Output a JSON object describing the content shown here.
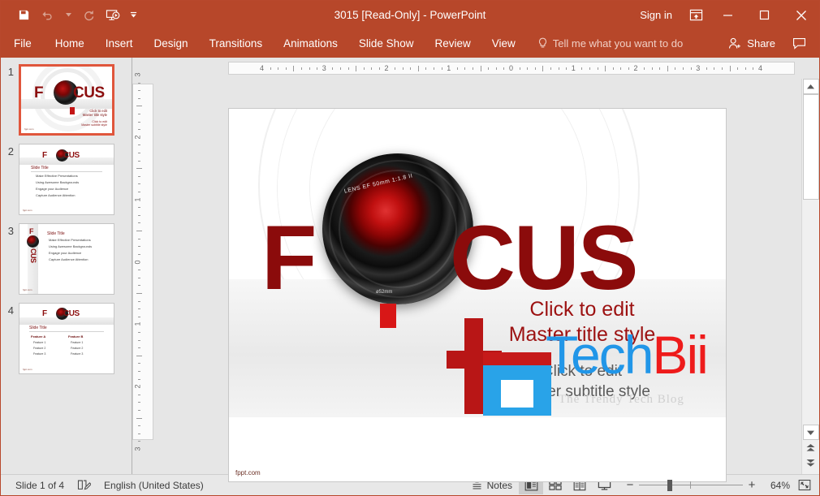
{
  "window": {
    "title": "3015 [Read-Only]  -  PowerPoint",
    "sign_in": "Sign in",
    "accent_color": "#b7472a"
  },
  "quick_access": {
    "items": [
      {
        "name": "save-icon",
        "label": "Save"
      },
      {
        "name": "undo-icon",
        "label": "Undo"
      },
      {
        "name": "redo-icon",
        "label": "Redo"
      },
      {
        "name": "start-slideshow-icon",
        "label": "Start From Beginning"
      },
      {
        "name": "customize-qat-icon",
        "label": "Customize Quick Access Toolbar"
      }
    ]
  },
  "window_controls": {
    "ribbon_display_options": "Ribbon Display Options",
    "minimize": "Minimize",
    "maximize": "Maximize",
    "close": "Close"
  },
  "ribbon": {
    "tabs": [
      {
        "label": "File"
      },
      {
        "label": "Home"
      },
      {
        "label": "Insert"
      },
      {
        "label": "Design"
      },
      {
        "label": "Transitions"
      },
      {
        "label": "Animations"
      },
      {
        "label": "Slide Show"
      },
      {
        "label": "Review"
      },
      {
        "label": "View"
      }
    ],
    "tell_me": "Tell me what you want to do",
    "share": "Share",
    "comments": "Comments"
  },
  "thumbnails": [
    {
      "number": "1",
      "selected": true,
      "title": "",
      "subtitle": "Click to edit Master title style",
      "footer": "fppt.com"
    },
    {
      "number": "2",
      "selected": false,
      "title": "Slide Title",
      "bullets": [
        "Make Effective Presentations",
        "Using Awesome Backgrounds",
        "Engage your Audience",
        "Capture Audience Attention"
      ],
      "footer": "fppt.com"
    },
    {
      "number": "3",
      "selected": false,
      "title": "Slide Title",
      "bullets": [
        "Make Effective Presentations",
        "Using Awesome Backgrounds",
        "Engage your Audience",
        "Capture Audience Attention"
      ],
      "footer": "fppt.com"
    },
    {
      "number": "4",
      "selected": false,
      "title": "Slide Title",
      "col_a_header": "Feature A",
      "col_b_header": "Feature B",
      "col_a": [
        "Feature 1",
        "Feature 2",
        "Feature 3"
      ],
      "col_b": [
        "Feature 1",
        "Feature 2",
        "Feature 3"
      ],
      "footer": "fppt.com"
    }
  ],
  "rulers": {
    "horizontal_labels": [
      "4",
      "3",
      "2",
      "1",
      "0",
      "1",
      "2",
      "3",
      "4"
    ],
    "vertical_labels": [
      "3",
      "2",
      "1",
      "0",
      "1",
      "2",
      "3"
    ]
  },
  "slide": {
    "brand_text": "FOCUS",
    "brand_f": "F",
    "brand_cus": "CUS",
    "lens_label": "LENS  EF  50mm  1:1.8  II",
    "lens_filter": "ø52mm",
    "title_placeholder": "Click to edit\nMaster title style",
    "title_line1": "Click to edit",
    "title_line2": "Master title style",
    "subtitle_line1": "Click to edit",
    "subtitle_line2": "Master subtitle style",
    "footer": "fppt.com"
  },
  "watermark": {
    "tech": "Tech",
    "bii": "Bii",
    "tagline": "The Trendy Tech Blog"
  },
  "status_bar": {
    "slide_count": "Slide 1 of 4",
    "language": "English (United States)",
    "notes": "Notes",
    "views": [
      {
        "name": "normal-view",
        "label": "Normal",
        "active": true
      },
      {
        "name": "slide-sorter-view",
        "label": "Slide Sorter",
        "active": false
      },
      {
        "name": "reading-view",
        "label": "Reading View",
        "active": false
      },
      {
        "name": "slide-show-view",
        "label": "Slide Show",
        "active": false
      }
    ],
    "zoom_out": "−",
    "zoom_in": "+",
    "zoom_level": "64%",
    "fit_label": "Fit slide to current window"
  }
}
